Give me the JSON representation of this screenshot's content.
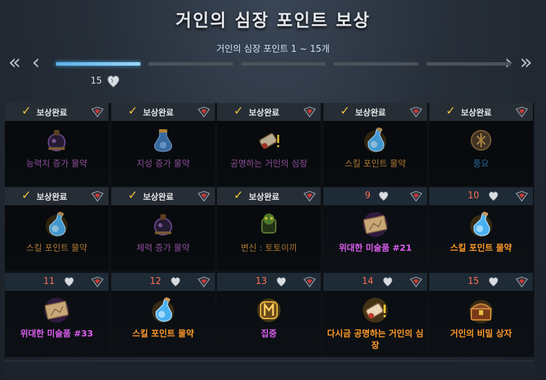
{
  "header": {
    "title": "거인의 심장 포인트 보상",
    "subtitle": "거인의 심장 포인트 1 ~ 15개",
    "nav_first": "«",
    "nav_prev": "‹",
    "nav_next": "›",
    "nav_last": "»"
  },
  "progress": {
    "points": "15",
    "segments": 5,
    "active_segment": 0,
    "icon": "heart-icon"
  },
  "colors": {
    "claimed_check": "#f0c63a",
    "number": "#ff6e54",
    "label_purple": "#c56ad6",
    "label_orange": "#ff9a2a",
    "label_blue": "#3d8fd0",
    "active_bar": "#5ab0e6"
  },
  "rewards": [
    {
      "status": "보상완료",
      "claimed": true,
      "number": "",
      "label": "능력치 증가 물약",
      "color": "purple",
      "icon": "potion-dark-icon"
    },
    {
      "status": "보상완료",
      "claimed": true,
      "number": "",
      "label": "지성 증가 물약",
      "color": "purple",
      "icon": "potion-purple-icon"
    },
    {
      "status": "보상완료",
      "claimed": true,
      "number": "",
      "label": "공명하는 거인의 심장",
      "color": "purple",
      "icon": "scroll-quest-icon"
    },
    {
      "status": "보상완료",
      "claimed": true,
      "number": "",
      "label": "스킬 포인트 물약",
      "color": "yellow",
      "icon": "skill-potion-icon"
    },
    {
      "status": "보상완료",
      "claimed": true,
      "number": "",
      "label": "풍요",
      "color": "blue",
      "icon": "rune-icon"
    },
    {
      "status": "보상완료",
      "claimed": true,
      "number": "",
      "label": "스킬 포인트 물약",
      "color": "yellow",
      "icon": "skill-potion-icon"
    },
    {
      "status": "보상완료",
      "claimed": true,
      "number": "",
      "label": "체력 증가 물약",
      "color": "purple",
      "icon": "potion-dark-icon"
    },
    {
      "status": "보상완료",
      "claimed": true,
      "number": "",
      "label": "변신 : 토토이끼",
      "color": "yellow",
      "icon": "transform-icon"
    },
    {
      "status": "",
      "claimed": false,
      "number": "9",
      "label": "위대한 미술품 #21",
      "color": "bright-purple",
      "icon": "painting-icon"
    },
    {
      "status": "",
      "claimed": false,
      "number": "10",
      "label": "스킬 포인트 물약",
      "color": "orange",
      "icon": "skill-potion-icon"
    },
    {
      "status": "",
      "claimed": false,
      "number": "11",
      "label": "위대한 미술품 #33",
      "color": "bright-purple",
      "icon": "painting-icon"
    },
    {
      "status": "",
      "claimed": false,
      "number": "12",
      "label": "스킬 포인트 물약",
      "color": "orange",
      "icon": "skill-potion-icon"
    },
    {
      "status": "",
      "claimed": false,
      "number": "13",
      "label": "집중",
      "color": "bright-purple",
      "icon": "rune-gold-icon"
    },
    {
      "status": "",
      "claimed": false,
      "number": "14",
      "label": "다시금 공명하는 거인의 심장",
      "color": "orange",
      "icon": "scroll-quest-gold-icon"
    },
    {
      "status": "",
      "claimed": false,
      "number": "15",
      "label": "거인의 비밀 상자",
      "color": "orange",
      "icon": "treasure-chest-icon"
    }
  ]
}
